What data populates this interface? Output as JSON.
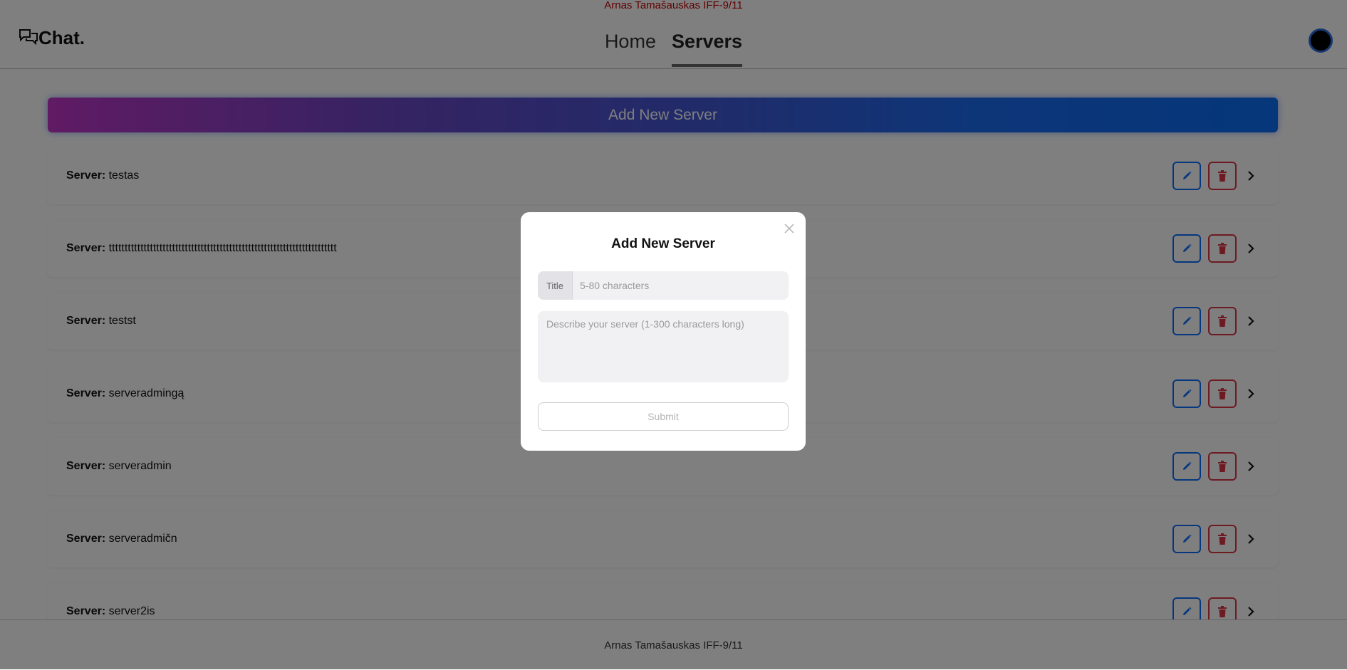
{
  "top_banner": "Arnas Tamašauskas IFF-9/11",
  "logo": {
    "text": "Chat."
  },
  "nav": [
    {
      "label": "Home"
    },
    {
      "label": "Servers"
    }
  ],
  "add_server_label": "Add New Server",
  "server_prefix": "Server:",
  "servers": [
    "testas",
    "tttttttttttttttttttttttttttttttttttttttttttttttttttttttttttttttttttttttt",
    "testst",
    "serveradmingą",
    "serveradmin",
    "serveradmičn",
    "server2is"
  ],
  "footer_text": "Arnas Tamašauskas IFF-9/11",
  "modal": {
    "title": "Add New Server",
    "title_prefix": "Title",
    "title_placeholder": "5-80 characters",
    "description_placeholder": "Describe your server (1-300 characters long)",
    "submit_label": "Submit"
  },
  "colors": {
    "edit": "#0d6efd",
    "delete": "#dc3545",
    "banner_text": "#c40000"
  }
}
